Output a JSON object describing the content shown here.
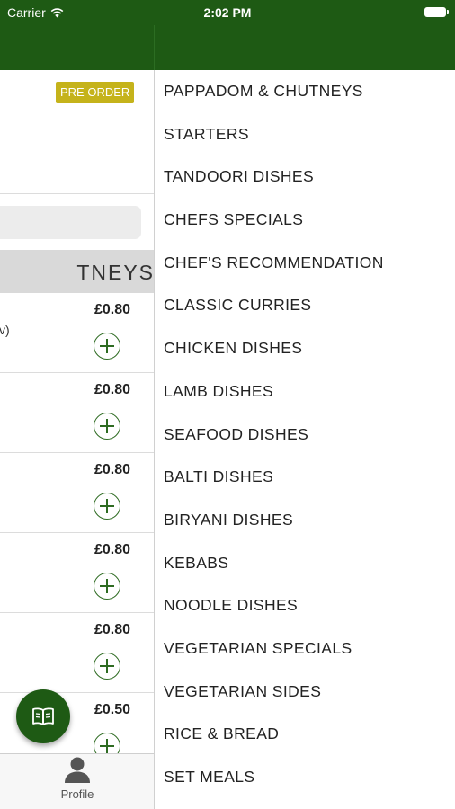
{
  "status_bar": {
    "carrier": "Carrier",
    "time": "2:02 PM"
  },
  "left_panel": {
    "pre_order_label": "PRE ORDER",
    "category_band": "TNEYS",
    "items": [
      {
        "price": "£0.80",
        "desc_fragment": "v)"
      },
      {
        "price": "£0.80"
      },
      {
        "price": "£0.80"
      },
      {
        "price": "£0.80"
      },
      {
        "price": "£0.80"
      },
      {
        "price": "£0.50"
      }
    ]
  },
  "bottom_tab": {
    "profile_label": "Profile"
  },
  "drawer": {
    "categories": [
      "PAPPADOM & CHUTNEYS",
      "STARTERS",
      "TANDOORI DISHES",
      "CHEFS SPECIALS",
      "CHEF'S RECOMMENDATION",
      "CLASSIC CURRIES",
      "CHICKEN DISHES",
      "LAMB DISHES",
      "SEAFOOD DISHES",
      "BALTI DISHES",
      "BIRYANI DISHES",
      "KEBABS",
      "NOODLE DISHES",
      "VEGETARIAN SPECIALS",
      "VEGETARIAN SIDES",
      "RICE & BREAD",
      "SET MEALS"
    ]
  },
  "colors": {
    "brand_green": "#1e5a14",
    "badge_yellow": "#c5b31b"
  },
  "icons": {
    "fab": "open-book-icon",
    "profile": "person-icon",
    "add": "plus-circle-icon"
  }
}
